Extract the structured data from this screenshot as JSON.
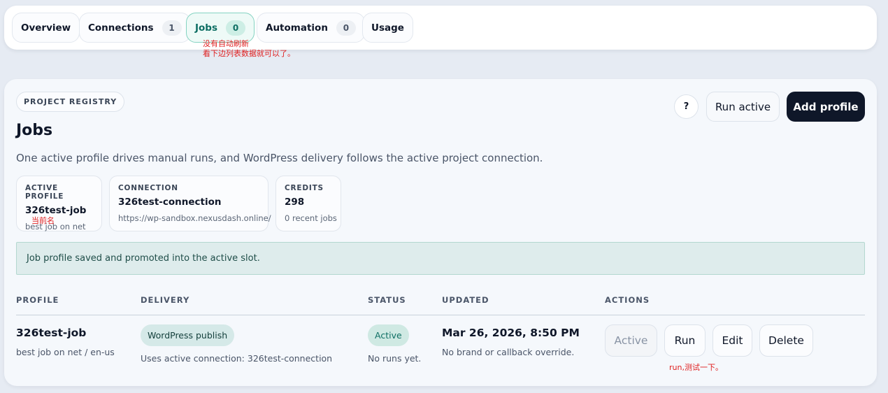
{
  "tabs": [
    {
      "label": "Overview",
      "count": null
    },
    {
      "label": "Connections",
      "count": "1"
    },
    {
      "label": "Jobs",
      "count": "0",
      "active": true
    },
    {
      "label": "Automation",
      "count": "0"
    },
    {
      "label": "Usage",
      "count": null
    }
  ],
  "annotations": {
    "jobs_note_line1": "没有自动刷新",
    "jobs_note_line2": "看下边列表数据就可以了。",
    "profile_note": "当前名",
    "run_note": "run,测试一下。"
  },
  "header": {
    "eyebrow": "PROJECT REGISTRY",
    "title": "Jobs",
    "description": "One active profile drives manual runs, and WordPress delivery follows the active project connection.",
    "help_label": "?",
    "run_active_label": "Run active",
    "add_profile_label": "Add profile"
  },
  "stats": {
    "active_profile": {
      "label": "ACTIVE PROFILE",
      "value": "326test-job",
      "sub": "best job on net"
    },
    "connection": {
      "label": "CONNECTION",
      "value": "326test-connection",
      "sub": "https://wp-sandbox.nexusdash.online/"
    },
    "credits": {
      "label": "CREDITS",
      "value": "298",
      "sub": "0 recent jobs"
    }
  },
  "notice": "Job profile saved and promoted into the active slot.",
  "table": {
    "columns": {
      "profile": "PROFILE",
      "delivery": "DELIVERY",
      "status": "STATUS",
      "updated": "UPDATED",
      "actions": "ACTIONS"
    },
    "rows": [
      {
        "profile": "326test-job",
        "profile_sub": "best job on net / en-us",
        "delivery_chip": "WordPress publish",
        "delivery_sub": "Uses active connection: 326test-connection",
        "status_chip": "Active",
        "status_sub": "No runs yet.",
        "updated": "Mar 26, 2026, 8:50 PM",
        "updated_sub": "No brand or callback override.",
        "actions": {
          "active": "Active",
          "run": "Run",
          "edit": "Edit",
          "delete": "Delete"
        }
      }
    ]
  },
  "colors": {
    "accent": "#0d6e63",
    "primary": "#0f1729",
    "annotation": "#e02020"
  }
}
